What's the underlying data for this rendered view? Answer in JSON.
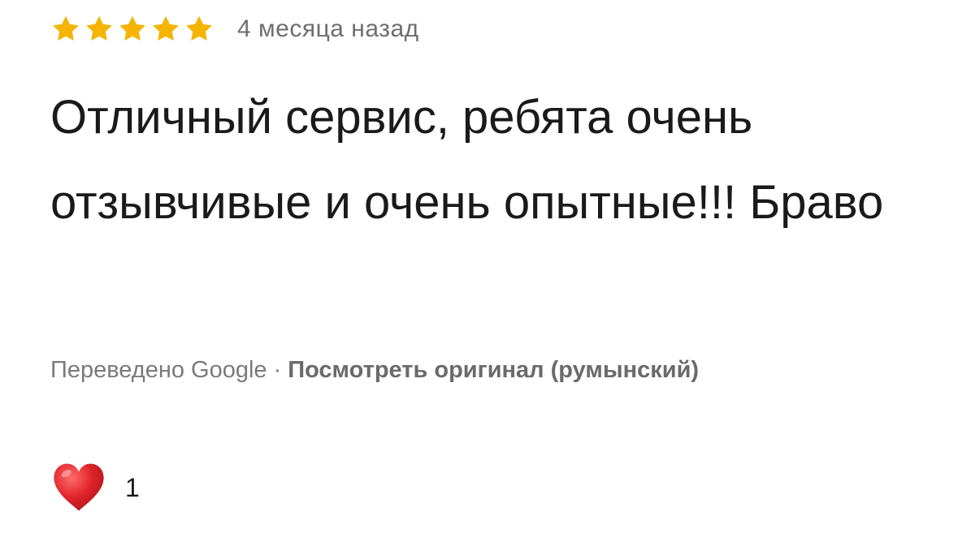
{
  "review": {
    "rating": 5,
    "rating_max": 5,
    "star_color": "#F4B400",
    "date": "4 месяца назад",
    "text": "Отличный сервис, ребята очень отзывчивые и очень опытные!!! Браво",
    "translated_label": "Переведено Google",
    "separator": "·",
    "view_original_label": "Посмотреть оригинал (румынский)",
    "reaction_icon": "heart-icon",
    "reaction_color": "#E0252B",
    "like_count": "1"
  }
}
